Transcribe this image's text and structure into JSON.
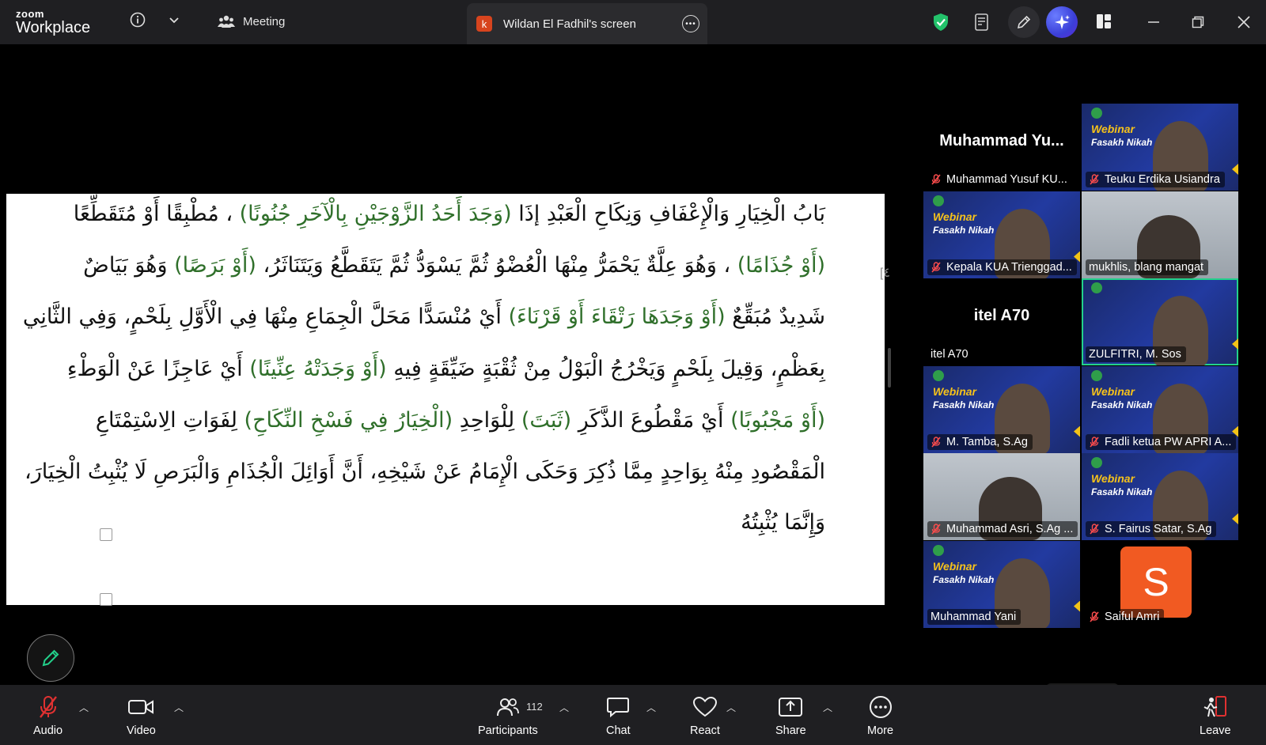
{
  "app": {
    "logo_line1": "zoom",
    "logo_line2": "Workplace"
  },
  "titlebar": {
    "meeting_label": "Meeting",
    "screen_badge": "k",
    "screen_title": "Wildan El Fadhil's screen"
  },
  "document": {
    "lines": [
      {
        "parts": [
          "بَابُ الْخِيَارِ وَالْإِعْفَافِ وَنِكَاحِ الْعَبْدِ إذَا ",
          "(وَجَدَ أَحَدُ الزَّوْجَيْنِ بِالْآخَرِ جُنُونًا)",
          " ، مُطْبِقًا أَوْ مُتَقَطِّعًا"
        ]
      },
      {
        "parts": [
          "",
          "(أَوْ جُذَامًا)",
          " ، وَهُوَ عِلَّةٌ يَحْمَرُّ مِنْهَا الْعُضْوُ ثُمَّ يَسْوَدُّ ثُمَّ يَتَقَطَّعُ وَيَتَنَاثَرُ، ",
          "(أَوْ بَرَصًا)",
          " وَهُوَ بَيَاضٌ"
        ]
      },
      {
        "parts": [
          "شَدِيدٌ مُبَقِّعٌ ",
          "(أَوْ وَجَدَهَا رَتْقَاءَ أَوْ قَرْنَاءَ)",
          " أَيْ مُنْسَدًّا مَحَلَّ الْجِمَاعِ مِنْهَا فِي الْأَوَّلِ بِلَحْمٍ، وَفِي الثَّانِي"
        ]
      },
      {
        "parts": [
          "بِعَظْمٍ، وَقِيلَ بِلَحْمٍ وَيَخْرُجُ الْبَوْلُ مِنْ ثُقْبَةٍ ضَيِّقَةٍ فِيهِ ",
          "(أَوْ وَجَدَتْهُ عِنِّينًا)",
          " أَيْ عَاجِزًا عَنْ الْوَطْءِ"
        ]
      },
      {
        "parts": [
          "",
          "(أَوْ مَجْبُوبًا)",
          " أَيْ مَقْطُوعَ الذَّكَرِ ",
          "(ثَبَتَ)",
          " لِلْوَاحِدِ ",
          "(الْخِيَارُ فِي فَسْخِ النِّكَاحِ)",
          " لِفَوَاتِ الِاسْتِمْتَاعِ"
        ]
      },
      {
        "parts": [
          "الْمَقْصُودِ مِنْهُ بِوَاحِدٍ مِمَّا ذُكِرَ وَحَكَى الْإِمَامُ عَنْ شَيْخِهِ، أَنَّ أَوَائِلَ الْجُذَامِ وَالْبَرَصِ لَا يُثْبِتُ الْخِيَارَ،"
        ]
      },
      {
        "parts": [
          "وَإِنَّمَا يُثْبِتُهُ"
        ]
      }
    ],
    "side_mark": "[٤"
  },
  "gallery": {
    "tiles": [
      {
        "name": "Muhammad Yusuf KU...",
        "display": "Muhammad  Yu...",
        "kind": "black",
        "muted": true
      },
      {
        "name": "Teuku Erdika Usiandra",
        "kind": "webinar",
        "muted": true,
        "webinar_title": "Webinar",
        "webinar_sub": "Fasakh Nikah"
      },
      {
        "name": "Kepala KUA Trienggad...",
        "kind": "webinar",
        "muted": true,
        "webinar_title": "Webinar",
        "webinar_sub": "Fasakh Nikah"
      },
      {
        "name": "mukhlis, blang mangat",
        "kind": "room",
        "muted": false
      },
      {
        "name": "itel A70",
        "display": "itel A70",
        "kind": "black",
        "muted": false
      },
      {
        "name": "ZULFITRI, M. Sos",
        "kind": "webinar",
        "muted": false,
        "selected": true
      },
      {
        "name": "M. Tamba, S.Ag",
        "kind": "webinar",
        "muted": true,
        "webinar_title": "Webinar",
        "webinar_sub": "Fasakh Nikah"
      },
      {
        "name": "Fadli ketua PW APRI A...",
        "kind": "webinar",
        "muted": true,
        "webinar_title": "Webinar",
        "webinar_sub": "Fasakh Nikah"
      },
      {
        "name": "Muhammad Asri, S.Ag ...",
        "kind": "room",
        "muted": true
      },
      {
        "name": "S. Fairus Satar, S.Ag",
        "kind": "webinar",
        "muted": true,
        "webinar_title": "Webinar",
        "webinar_sub": "Fasakh Nikah"
      },
      {
        "name": "Muhammad Yani",
        "kind": "webinar",
        "muted": false,
        "webinar_title": "Webinar",
        "webinar_sub": "Fasakh Nikah"
      },
      {
        "name": "Saiful Amri",
        "kind": "avatar",
        "muted": true,
        "avatar_letter": "S"
      }
    ]
  },
  "toolbar": {
    "audio": "Audio",
    "video": "Video",
    "participants": "Participants",
    "participants_count": "112",
    "chat": "Chat",
    "react": "React",
    "share": "Share",
    "more": "More",
    "leave": "Leave"
  },
  "colors": {
    "accent_green": "#23d18b",
    "leave_red": "#e03131",
    "arabic_green": "#2f6f2a",
    "avatar_orange": "#f15a22"
  }
}
